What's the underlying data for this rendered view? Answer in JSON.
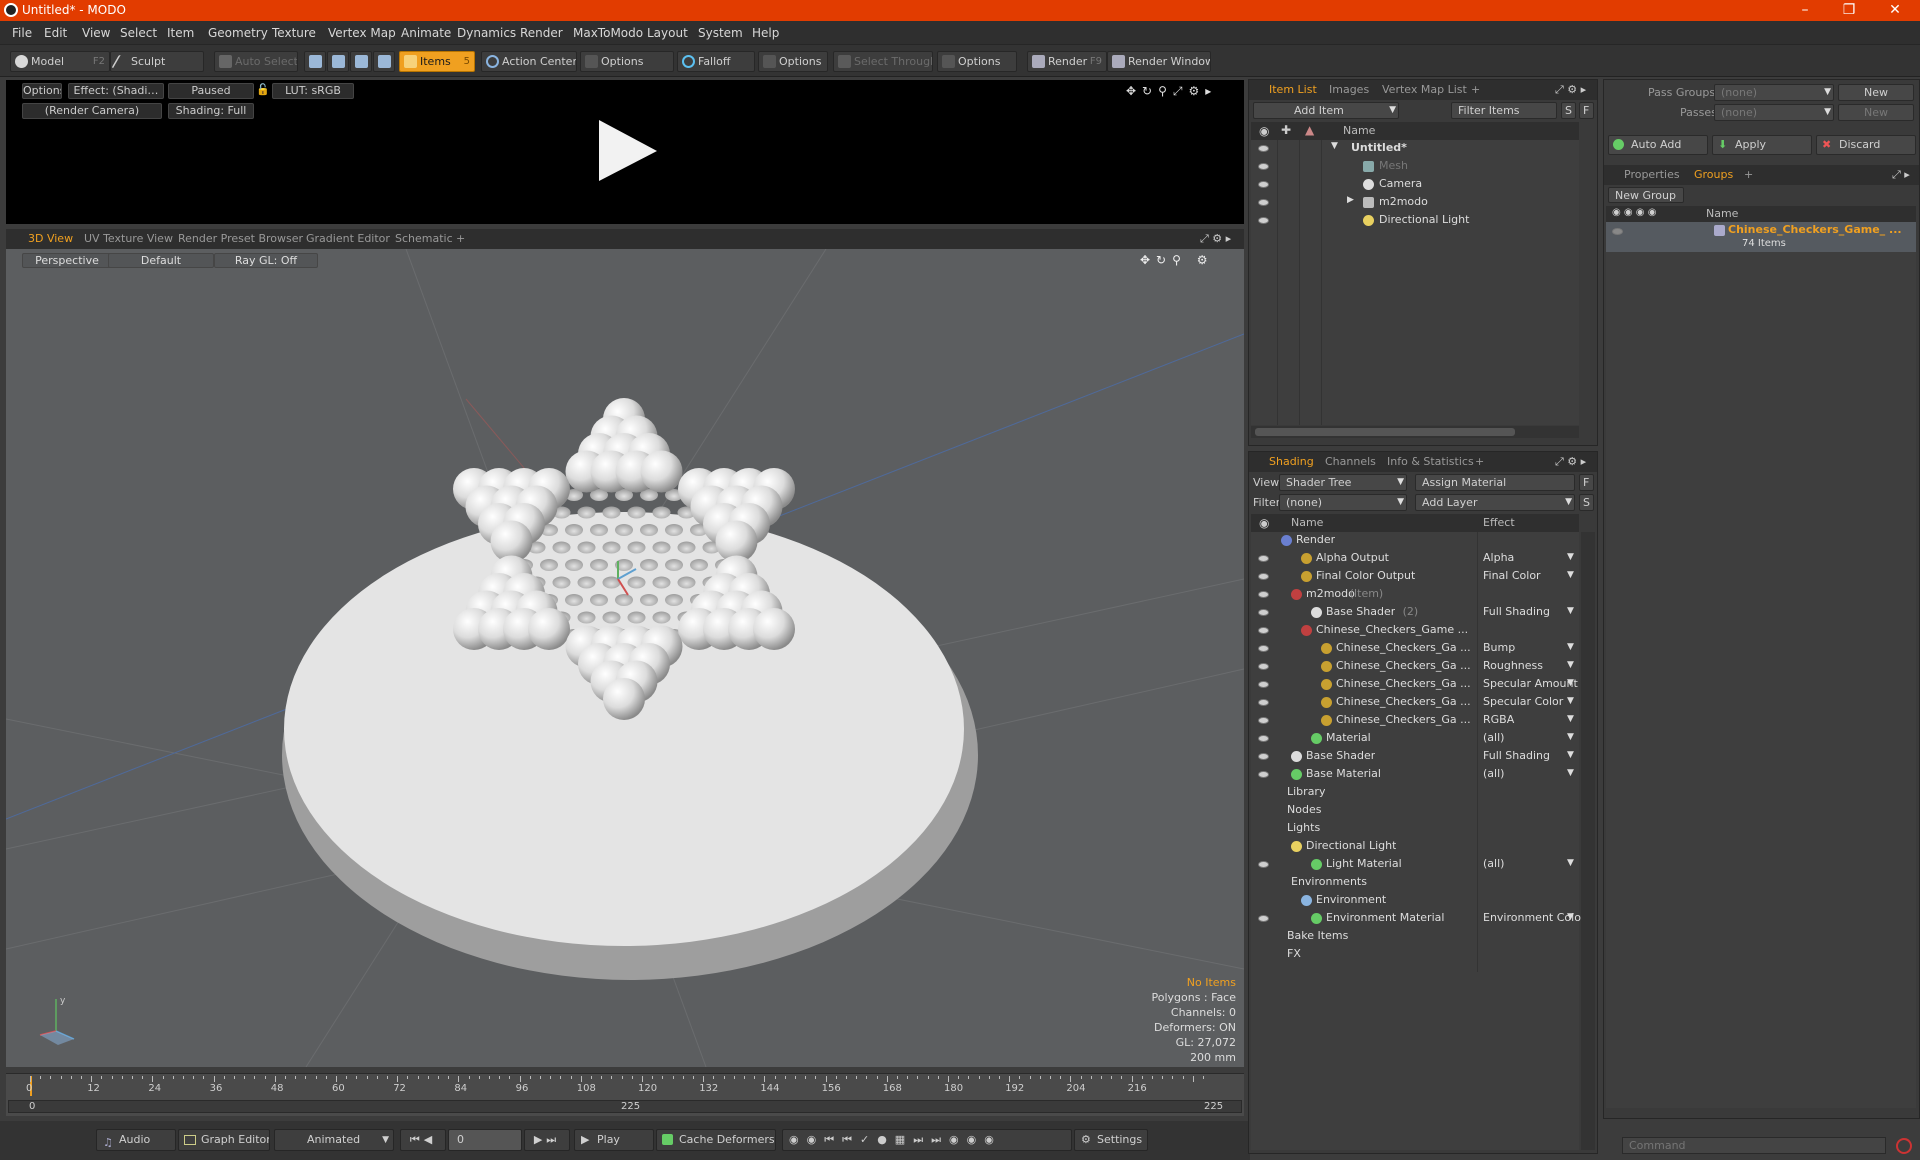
{
  "window": {
    "title": "Untitled* - MODO"
  },
  "menu": [
    "File",
    "Edit",
    "View",
    "Select",
    "Item",
    "Geometry",
    "Texture",
    "Vertex Map",
    "Animate",
    "Dynamics",
    "Render",
    "MaxToModo",
    "Layout",
    "System",
    "Help"
  ],
  "toolbar": {
    "model": "Model",
    "model_key": "F2",
    "sculpt": "Sculpt",
    "auto_select": "Auto Select",
    "items": "Items",
    "action_center": "Action Center",
    "options1": "Options",
    "falloff": "Falloff",
    "options2": "Options",
    "select_through": "Select Through",
    "options3": "Options",
    "render": "Render",
    "render_key": "F9",
    "render_window": "Render Window"
  },
  "preview": {
    "options": "Options",
    "effect": "Effect: (Shadi…",
    "paused": "Paused",
    "lut": "LUT: sRGB",
    "camera": "(Render Camera)",
    "shading": "Shading: Full"
  },
  "viewport_tabs": [
    "3D View",
    "UV Texture View",
    "Render Preset Browser",
    "Gradient Editor",
    "Schematic",
    "+"
  ],
  "viewport": {
    "perspective": "Perspective",
    "default": "Default",
    "raygl": "Ray GL: Off",
    "stats": [
      "No Items",
      "Polygons : Face",
      "Channels: 0",
      "Deformers: ON",
      "GL: 27,072",
      "200 mm"
    ]
  },
  "timeline": {
    "ticks": [
      "0",
      "12",
      "24",
      "36",
      "48",
      "60",
      "72",
      "84",
      "96",
      "108",
      "120",
      "132",
      "144",
      "156",
      "168",
      "180",
      "192",
      "204",
      "216"
    ],
    "start": "0",
    "mid": "225",
    "end": "225"
  },
  "bottombar": {
    "audio": "Audio",
    "graph_editor": "Graph Editor",
    "animated": "Animated",
    "frame": "0",
    "play": "Play",
    "cache": "Cache Deformers",
    "settings": "Settings"
  },
  "item_panel": {
    "tabs": [
      "Item List",
      "Images",
      "Vertex Map List",
      "+"
    ],
    "add_item": "Add Item",
    "filter": "Filter Items",
    "s": "S",
    "f": "F",
    "col_name": "Name",
    "items": [
      {
        "label": "Untitled*",
        "bold": true
      },
      {
        "label": "Mesh",
        "dim": true
      },
      {
        "label": "Camera"
      },
      {
        "label": "m2modo"
      },
      {
        "label": "Directional Light"
      }
    ]
  },
  "groups_panel": {
    "pass_groups": "Pass Groups",
    "none1": "(none)",
    "new1": "New",
    "passes": "Passes",
    "none2": "(none)",
    "new2": "New",
    "auto_add": "Auto Add",
    "apply": "Apply",
    "discard": "Discard",
    "tabs": [
      "Properties",
      "Groups",
      "+"
    ],
    "new_group": "New Group",
    "col_name": "Name",
    "group_name": "Chinese_Checkers_Game_ ...",
    "group_count": "74 Items"
  },
  "shading_panel": {
    "tabs": [
      "Shading",
      "Channels",
      "Info & Statistics",
      "+"
    ],
    "view_label": "View",
    "view_value": "Shader Tree",
    "assign": "Assign Material",
    "f": "F",
    "filter_label": "Filter",
    "filter_value": "(none)",
    "add_layer": "Add Layer",
    "s": "S",
    "col_name": "Name",
    "col_effect": "Effect",
    "rows": [
      {
        "name": "Render",
        "effect": ""
      },
      {
        "name": "Alpha Output",
        "effect": "Alpha"
      },
      {
        "name": "Final Color Output",
        "effect": "Final Color"
      },
      {
        "name": "m2modo",
        "extra": "(Item)",
        "effect": ""
      },
      {
        "name": "Base Shader",
        "extra": "(2)",
        "effect": "Full Shading"
      },
      {
        "name": "Chinese_Checkers_Game ...",
        "effect": ""
      },
      {
        "name": "Chinese_Checkers_Ga ...",
        "effect": "Bump"
      },
      {
        "name": "Chinese_Checkers_Ga ...",
        "effect": "Roughness"
      },
      {
        "name": "Chinese_Checkers_Ga ...",
        "effect": "Specular Amount"
      },
      {
        "name": "Chinese_Checkers_Ga ...",
        "effect": "Specular Color"
      },
      {
        "name": "Chinese_Checkers_Ga ...",
        "effect": "RGBA"
      },
      {
        "name": "Material",
        "effect": "(all)"
      },
      {
        "name": "Base Shader",
        "effect": "Full Shading"
      },
      {
        "name": "Base Material",
        "effect": "(all)"
      },
      {
        "name": "Library",
        "effect": ""
      },
      {
        "name": "Nodes",
        "effect": ""
      },
      {
        "name": "Lights",
        "effect": ""
      },
      {
        "name": "Directional Light",
        "effect": ""
      },
      {
        "name": "Light Material",
        "effect": "(all)"
      },
      {
        "name": "Environments",
        "effect": ""
      },
      {
        "name": "Environment",
        "effect": ""
      },
      {
        "name": "Environment Material",
        "effect": "Environment Color"
      },
      {
        "name": "Bake Items",
        "effect": ""
      },
      {
        "name": "FX",
        "effect": ""
      }
    ]
  },
  "command": {
    "placeholder": "Command"
  },
  "colors": {
    "accent": "#f0a020",
    "title_bar": "#e23c00"
  }
}
